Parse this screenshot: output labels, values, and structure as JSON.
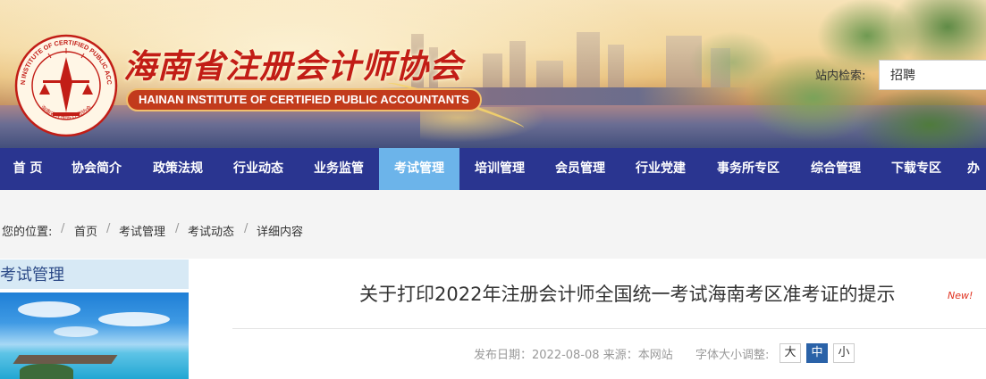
{
  "header": {
    "title_cn": "海南省注册会计师协会",
    "title_en": "HAINAN INSTITUTE OF CERTIFIED PUBLIC ACCOUNTANTS",
    "emblem_ring_top": "THE HAINAN INSTITUTE OF CERTIFIED PUBLIC ACCOUNTANTS",
    "emblem_ring_bottom": "海南省注册会计师协会",
    "search_label": "站内检索:",
    "search_value": "招聘"
  },
  "nav": {
    "items": [
      {
        "label": "首 页"
      },
      {
        "label": "协会简介"
      },
      {
        "label": "政策法规"
      },
      {
        "label": "行业动态"
      },
      {
        "label": "业务监管"
      },
      {
        "label": "考试管理",
        "active": true
      },
      {
        "label": "培训管理"
      },
      {
        "label": "会员管理"
      },
      {
        "label": "行业党建"
      },
      {
        "label": "事务所专区"
      },
      {
        "label": "综合管理"
      },
      {
        "label": "下载专区"
      },
      {
        "label": "办"
      }
    ]
  },
  "breadcrumb": {
    "prefix": "您的位置:",
    "items": [
      "首页",
      "考试管理",
      "考试动态",
      "详细内容"
    ],
    "separator": "/"
  },
  "sidebar": {
    "heading": "考试管理"
  },
  "article": {
    "title": "关于打印2022年注册会计师全国统一考试海南考区准考证的提示",
    "new_badge": "New!",
    "publish_date": "发布日期：2022-08-08",
    "source": "来源：本网站",
    "font_size_label": "字体大小调整:",
    "font_sizes": [
      {
        "label": "大"
      },
      {
        "label": "中",
        "active": true
      },
      {
        "label": "小"
      }
    ]
  },
  "colors": {
    "nav_bg": "#2a3590",
    "nav_active": "#6cb4ea",
    "title_red": "#c21d16",
    "sidebar_head_bg": "#d7e9f5",
    "font_btn_active": "#2a62a8"
  }
}
